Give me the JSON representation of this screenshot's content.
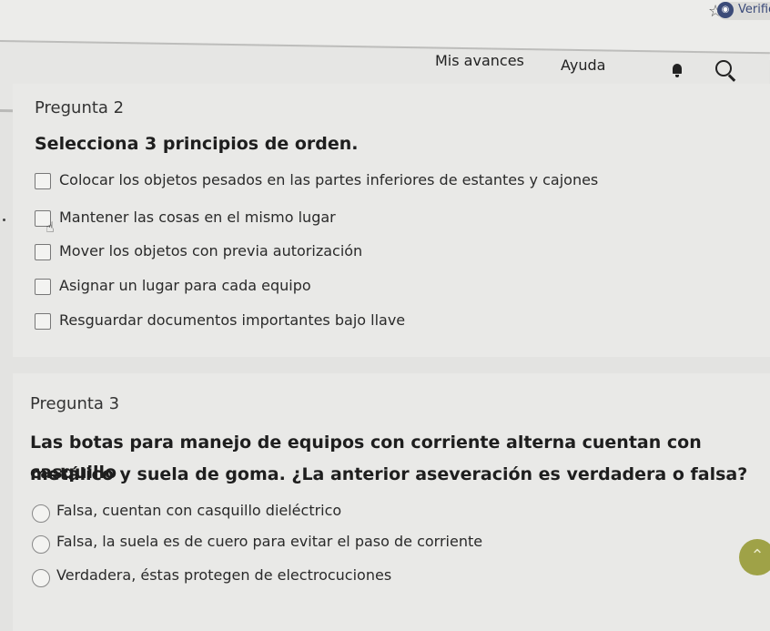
{
  "browser": {
    "bookmark_icon": "star-outline-icon",
    "verify_label": "Verific"
  },
  "nav": {
    "progress_label": "Mis avances",
    "help_label": "Ayuda",
    "icons": [
      "bell-icon",
      "search-icon"
    ]
  },
  "question2": {
    "number": "Pregunta 2",
    "title": "Selecciona 3 principios de orden.",
    "options": [
      "Colocar los objetos pesados en las partes inferiores de estantes y cajones",
      "Mantener las cosas en el mismo lugar",
      "Mover los objetos con previa autorización",
      "Asignar un lugar para cada equipo",
      "Resguardar documentos importantes bajo llave"
    ]
  },
  "question3": {
    "number": "Pregunta 3",
    "title_line1": "Las botas para manejo de equipos con corriente alterna cuentan con casquillo",
    "title_line2": "metálico y suela de goma. ¿La anterior aseveración es verdadera o falsa?",
    "options": [
      "Falsa, cuentan con casquillo dieléctrico",
      "Falsa, la suela es de cuero para evitar el paso de corriente",
      "Verdadera, éstas protegen de electrocuciones"
    ]
  },
  "scroll_top_icon": "double-chevron-up-icon"
}
